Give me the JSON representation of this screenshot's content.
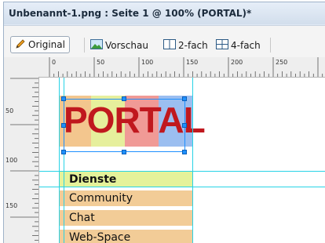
{
  "window": {
    "title": "Unbenannt-1.png : Seite 1 @ 100% (PORTAL)*"
  },
  "toolbar": {
    "original": "Original",
    "preview": "Vorschau",
    "two_up": "2-fach",
    "four_up": "4-fach"
  },
  "ruler": {
    "h_labels": [
      "0",
      "50",
      "100",
      "150",
      "200",
      "250"
    ],
    "v_labels": [
      "50",
      "100",
      "150"
    ]
  },
  "canvas": {
    "logo_text": "PORTAL",
    "logo_stripes": [
      "#f3c68e",
      "#e6ef9c",
      "#f09a96",
      "#9bbef0"
    ],
    "logo_text_color": "#c0181e",
    "menu": [
      {
        "label": "Dienste",
        "color": "#e5f29a",
        "bold": true
      },
      {
        "label": "Community",
        "color": "#f2cc97",
        "bold": false
      },
      {
        "label": "Chat",
        "color": "#f2cc97",
        "bold": false
      },
      {
        "label": "Web-Space",
        "color": "#f2cc97",
        "bold": false
      }
    ],
    "guide_color": "#27d3e6",
    "selection_color": "#1e90ff"
  }
}
